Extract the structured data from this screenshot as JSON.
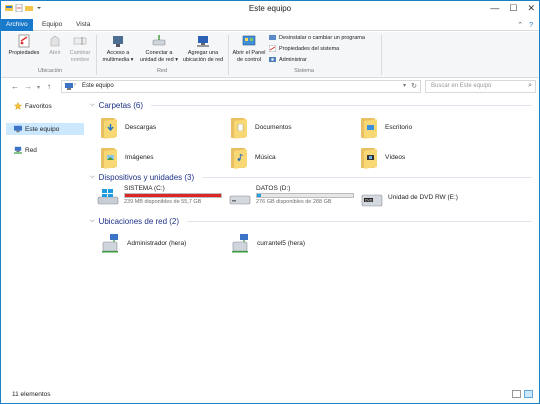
{
  "window": {
    "title": "Este equipo",
    "controls": [
      "—",
      "☐",
      "✕"
    ]
  },
  "ribbon_tabs": [
    {
      "label": "Archivo",
      "active": true
    },
    {
      "label": "Equipo",
      "active": false
    },
    {
      "label": "Vista",
      "active": false
    }
  ],
  "ribbon": {
    "ubicacion": {
      "label": "Ubicación",
      "buttons": [
        {
          "line1": "Propiedades",
          "line2": "",
          "enabled": true,
          "icon": "properties-icon"
        },
        {
          "line1": "Abrir",
          "line2": "",
          "enabled": false,
          "icon": "open-icon"
        },
        {
          "line1": "Cambiar",
          "line2": "nombre",
          "enabled": false,
          "icon": "rename-icon"
        }
      ]
    },
    "red": {
      "label": "Red",
      "buttons": [
        {
          "line1": "Acceso a",
          "line2": "multimedia ▾",
          "icon": "media-access-icon"
        },
        {
          "line1": "Conectar a",
          "line2": "unidad de red ▾",
          "icon": "map-drive-icon"
        },
        {
          "line1": "Agregar una",
          "line2": "ubicación de red",
          "icon": "add-network-location-icon"
        }
      ]
    },
    "sistema": {
      "label": "Sistema",
      "open_control_panel": {
        "line1": "Abrir el Panel",
        "line2": "de control"
      },
      "items": [
        "Desinstalar o cambiar un programa",
        "Propiedades del sistema",
        "Administrar"
      ]
    }
  },
  "address": {
    "path": "Este equipo",
    "search_placeholder": "Buscar en Este equipo"
  },
  "sidebar": {
    "items": [
      {
        "label": "Favoritos",
        "icon": "star-icon",
        "selected": false
      },
      {
        "label": "Este equipo",
        "icon": "computer-icon",
        "selected": true
      },
      {
        "label": "Red",
        "icon": "network-icon",
        "selected": false
      }
    ]
  },
  "groups": {
    "carpetas": {
      "title": "Carpetas (6)"
    },
    "dispositivos": {
      "title": "Dispositivos y unidades (3)"
    },
    "ubicaciones": {
      "title": "Ubicaciones de red (2)"
    }
  },
  "folders": [
    {
      "name": "Descargas",
      "badge": "download-arrow-icon"
    },
    {
      "name": "Documentos",
      "badge": "document-icon"
    },
    {
      "name": "Escritorio",
      "badge": "desktop-icon"
    },
    {
      "name": "Imágenes",
      "badge": "pictures-icon"
    },
    {
      "name": "Música",
      "badge": "music-note-icon"
    },
    {
      "name": "Vídeos",
      "badge": "film-strip-icon"
    }
  ],
  "drives": [
    {
      "name": "SISTEMA (C:)",
      "free": "239 MB disponibles de 55,7 GB",
      "used_fraction": 0.996,
      "bar_color": "#da2626",
      "icon": "windows-drive-icon"
    },
    {
      "name": "DATOS (D:)",
      "free": "276 GB disponibles de 288 GB",
      "used_fraction": 0.042,
      "bar_color": "#26a0da",
      "icon": "hard-drive-icon"
    },
    {
      "name": "Unidad de DVD RW (E:)",
      "free": "",
      "icon": "dvd-drive-icon"
    }
  ],
  "network_locations": [
    {
      "name": "Administrador (hera)",
      "icon": "network-share-icon"
    },
    {
      "name": "currantel5 (hera)",
      "icon": "network-share-icon"
    }
  ],
  "status": {
    "count": "11 elementos"
  },
  "colors": {
    "accent": "#1979ca",
    "selection": "#cce8ff",
    "group_header": "#1e3287",
    "folder": "#f8d775",
    "drive_full": "#da2626",
    "drive_ok": "#26a0da"
  }
}
